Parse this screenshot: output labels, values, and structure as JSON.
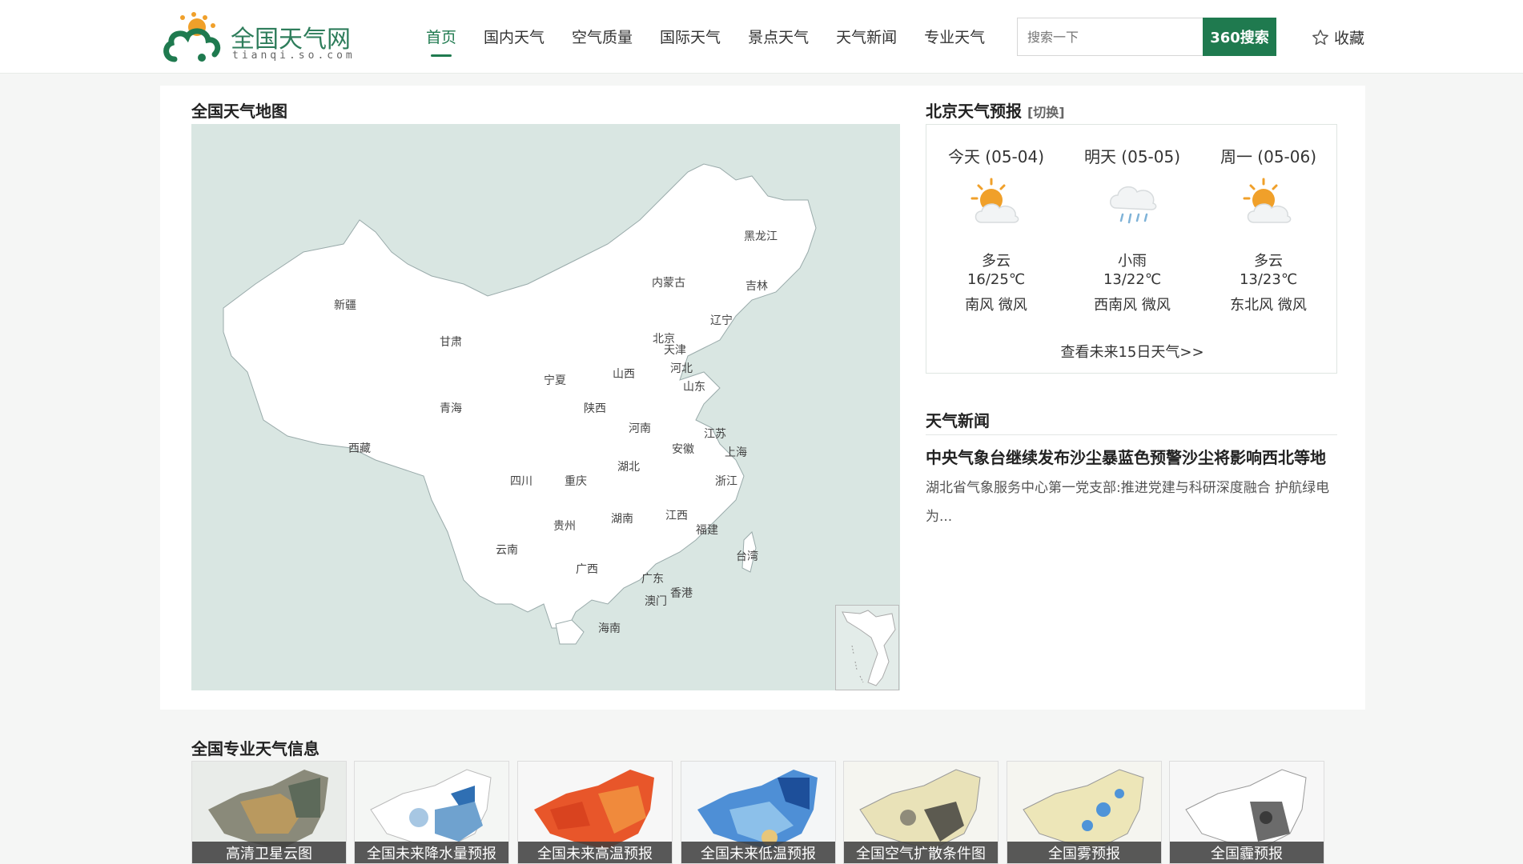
{
  "header": {
    "logo_text": "全国天气网",
    "logo_sub": "tianqi.so.com",
    "nav": [
      "首页",
      "国内天气",
      "空气质量",
      "国际天气",
      "景点天气",
      "天气新闻",
      "专业天气"
    ],
    "search_placeholder": "搜索一下",
    "search_button": "360搜索",
    "favorite": "收藏",
    "brand_color": "#1f7a4f"
  },
  "map": {
    "title": "全国天气地图",
    "provinces": [
      "黑龙江",
      "吉林",
      "辽宁",
      "内蒙古",
      "新疆",
      "甘肃",
      "北京",
      "天津",
      "河北",
      "山西",
      "宁夏",
      "山东",
      "青海",
      "陕西",
      "河南",
      "江苏",
      "西藏",
      "安徽",
      "上海",
      "湖北",
      "四川",
      "重庆",
      "浙江",
      "贵州",
      "湖南",
      "江西",
      "福建",
      "云南",
      "广西",
      "台湾",
      "广东",
      "香港",
      "澳门",
      "海南"
    ]
  },
  "forecast": {
    "title": "北京天气预报",
    "switch": "[切换]",
    "days": [
      {
        "date": "今天 (05-04)",
        "icon": "partly-cloudy-icon",
        "cond": "多云",
        "temp": "16/25℃",
        "wind": "南风 微风"
      },
      {
        "date": "明天 (05-05)",
        "icon": "light-rain-icon",
        "cond": "小雨",
        "temp": "13/22℃",
        "wind": "西南风 微风"
      },
      {
        "date": "周一 (05-06)",
        "icon": "partly-cloudy-icon",
        "cond": "多云",
        "temp": "13/23℃",
        "wind": "东北风 微风"
      }
    ],
    "more": "查看未来15日天气>>"
  },
  "news": {
    "title": "天气新闻",
    "headline": "中央气象台继续发布沙尘暴蓝色预警沙尘将影响西北等地",
    "summary": "湖北省气象服务中心第一党支部:推进党建与科研深度融合 护航绿电为..."
  },
  "pro": {
    "title": "全国专业天气信息",
    "items": [
      "高清卫星云图",
      "全国未来降水量预报",
      "全国未来高温预报",
      "全国未来低温预报",
      "全国空气扩散条件图",
      "全国雾预报",
      "全国霾预报"
    ]
  }
}
